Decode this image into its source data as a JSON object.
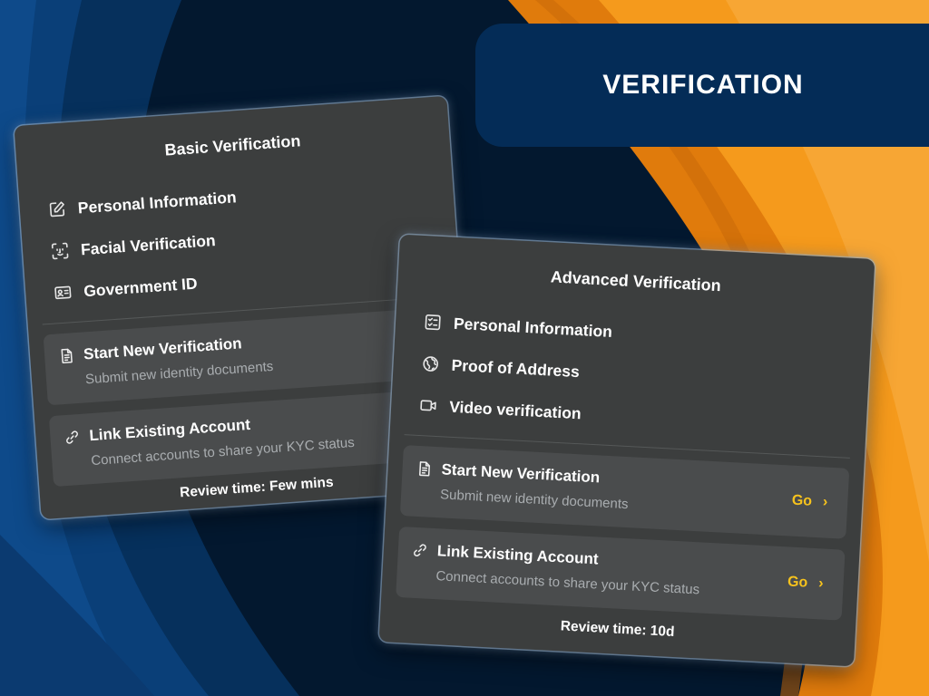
{
  "banner": {
    "title": "VERIFICATION"
  },
  "colors": {
    "accent_orange": "#f08c12",
    "navy": "#042c57",
    "card": "#3c3e3e",
    "go_yellow": "#f6c21d"
  },
  "basic": {
    "title": "Basic Verification",
    "items": [
      {
        "label": "Personal Information",
        "icon": "edit-icon"
      },
      {
        "label": "Facial Verification",
        "icon": "face-scan-icon"
      },
      {
        "label": "Government ID",
        "icon": "id-card-icon"
      }
    ],
    "options": [
      {
        "title": "Start New Verification",
        "subtitle": "Submit new identity documents",
        "icon": "document-icon"
      },
      {
        "title": "Link Existing Account",
        "subtitle": "Connect accounts to share your KYC status",
        "icon": "link-icon"
      }
    ],
    "review": "Review time: Few mins"
  },
  "advanced": {
    "title": "Advanced Verification",
    "items": [
      {
        "label": "Personal Information",
        "icon": "checklist-icon"
      },
      {
        "label": "Proof of Address",
        "icon": "globe-icon"
      },
      {
        "label": "Video verification",
        "icon": "video-icon"
      }
    ],
    "options": [
      {
        "title": "Start New Verification",
        "subtitle": "Submit new identity documents",
        "go": "Go",
        "icon": "document-icon"
      },
      {
        "title": "Link Existing Account",
        "subtitle": "Connect accounts to share your KYC status",
        "go": "Go",
        "icon": "link-icon"
      }
    ],
    "review": "Review time: 10d"
  }
}
